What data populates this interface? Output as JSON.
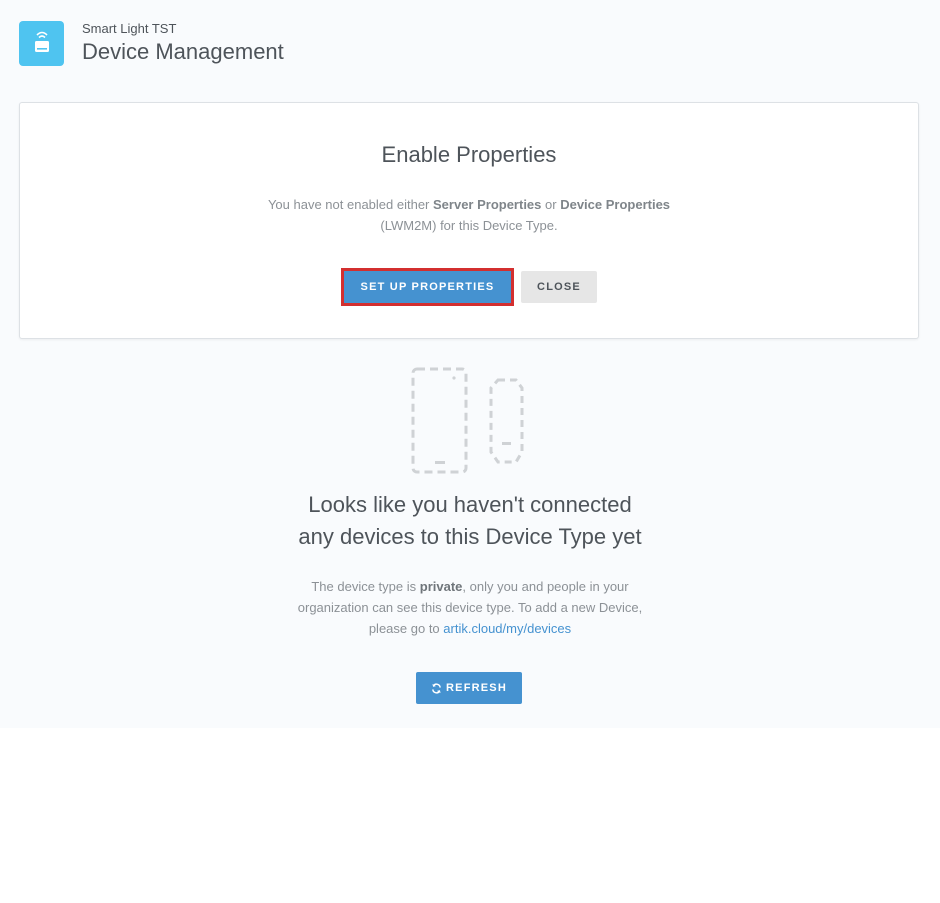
{
  "header": {
    "subtitle": "Smart Light TST",
    "title": "Device Management",
    "icon": "smart-light-icon"
  },
  "enable_card": {
    "title": "Enable Properties",
    "desc_prefix": "You have not enabled either ",
    "server_properties": "Server Properties",
    "desc_or": " or ",
    "device_properties": "Device Properties",
    "desc_line2": "(LWM2M) for this Device Type.",
    "setup_button": "SET UP PROPERTIES",
    "close_button": "CLOSE"
  },
  "empty_state": {
    "heading_line1": "Looks like you haven't connected",
    "heading_line2": "any devices to this Device Type yet",
    "text_prefix": "The device type is ",
    "text_private": "private",
    "text_mid": ", only you and people in your",
    "text_line2": "organization can see this device type. To add a new Device,",
    "text_line3_prefix": "please go to ",
    "link": "artik.cloud/my/devices",
    "refresh_button": "REFRESH"
  },
  "colors": {
    "accent": "#4592d0",
    "app_icon_bg": "#4fc4f0",
    "highlight_border": "#d32f2f"
  }
}
